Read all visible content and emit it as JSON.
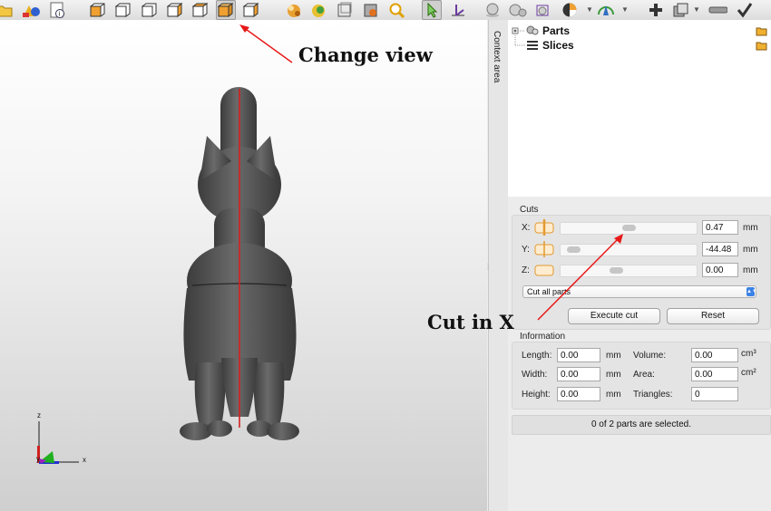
{
  "toolbar": {
    "buttons": [
      "open-icon",
      "primitives-icon",
      "info-icon",
      "view-front-icon",
      "view-back-icon",
      "view-left-icon",
      "view-right-icon",
      "view-top-icon",
      "view-iso-icon",
      "view-bottom-icon",
      "shading-icon",
      "texture-icon",
      "wireframe-icon",
      "outline-icon",
      "zoom-icon",
      "select-arrow-icon",
      "measure-icon",
      "sphere-icon",
      "spheres-icon",
      "bounding-box-icon",
      "color-wheel-icon",
      "transform-icon",
      "add-icon",
      "copy-icon",
      "minus-icon",
      "check-icon"
    ]
  },
  "annotations": {
    "change_view": "Change view",
    "cut_in_x": "Cut in X"
  },
  "viewport": {
    "axes": {
      "z": "z",
      "y": "y",
      "x": "x"
    },
    "colors": {
      "model": "#5a5a5a",
      "cut_plane": "#d42020",
      "arrow": "#e81818"
    }
  },
  "context": {
    "label": "Context area"
  },
  "tree": {
    "items": [
      {
        "label": "Parts"
      },
      {
        "label": "Slices"
      }
    ]
  },
  "cuts": {
    "title": "Cuts",
    "x": {
      "label": "X:",
      "value": "0.47",
      "unit": "mm",
      "slider_fraction": 0.5
    },
    "y": {
      "label": "Y:",
      "value": "-44.48",
      "unit": "mm",
      "slider_fraction": 0.05
    },
    "z": {
      "label": "Z:",
      "value": "0.00",
      "unit": "mm",
      "slider_fraction": 0.4
    },
    "mode": "Cut all parts",
    "execute": "Execute cut",
    "reset": "Reset"
  },
  "information": {
    "title": "Information",
    "length": {
      "label": "Length:",
      "value": "0.00",
      "unit": "mm"
    },
    "width": {
      "label": "Width:",
      "value": "0.00",
      "unit": "mm"
    },
    "height": {
      "label": "Height:",
      "value": "0.00",
      "unit": "mm"
    },
    "volume": {
      "label": "Volume:",
      "value": "0.00",
      "unit": "cm³"
    },
    "area": {
      "label": "Area:",
      "value": "0.00",
      "unit": "cm²"
    },
    "triangles": {
      "label": "Triangles:",
      "value": "0"
    }
  },
  "status": "0 of 2 parts are selected."
}
